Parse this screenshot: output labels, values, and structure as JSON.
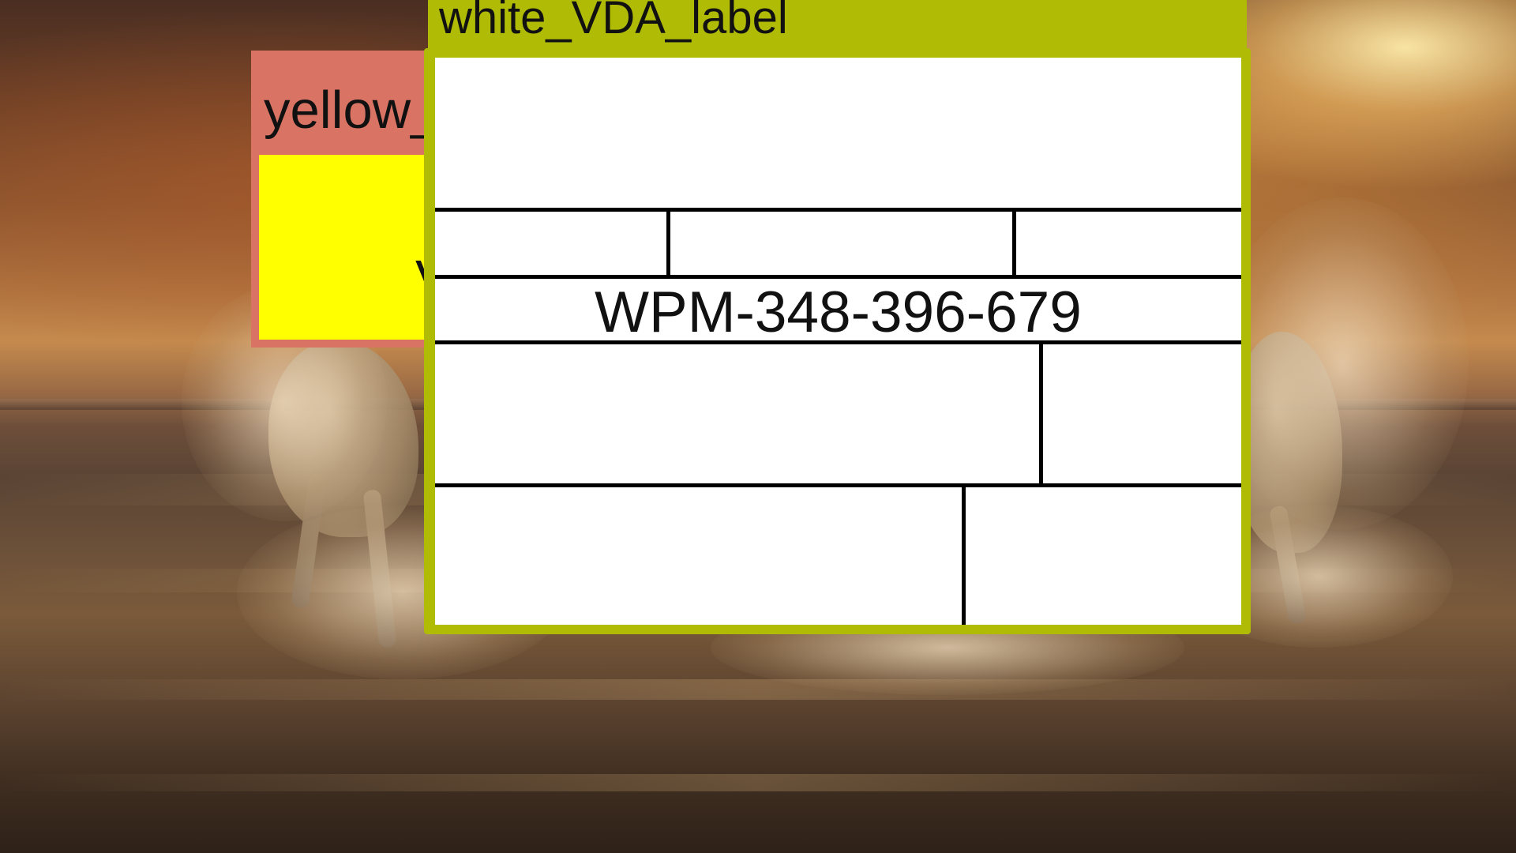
{
  "yellow_label": {
    "tag_text": "yellow_",
    "box_text": "V",
    "tag_color": "#d97363",
    "box_color": "#ffff00"
  },
  "white_vda_label": {
    "tag_text": "white_VDA_label",
    "code": "WPM-348-396-679",
    "tag_color": "#afbb05",
    "sheet_color": "#ffffff"
  }
}
